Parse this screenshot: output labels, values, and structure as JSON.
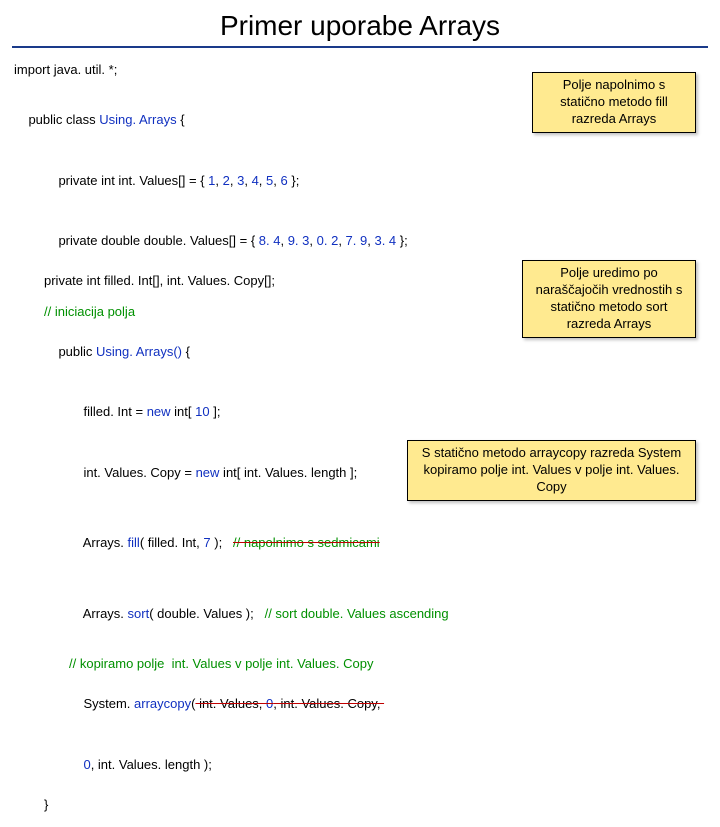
{
  "title": "Primer uporabe Arrays",
  "code": {
    "l1": "import java. util. *;",
    "l2a": "public class ",
    "l2b": "Using. Arrays",
    "l2c": " {",
    "l3a": "private int int. Values[] = { ",
    "l3b": "1",
    "l3c": "2",
    "l3d": "3",
    "l3e": "4",
    "l3f": "5",
    "l3g": "6",
    "l3h": " };",
    "l4a": "private double double. Values[] = { ",
    "l4b": "8. 4",
    "l4c": "9. 3",
    "l4d": "0. 2",
    "l4e": "7. 9",
    "l4f": "3. 4",
    "l4g": " };",
    "l5": "private int filled. Int[], int. Values. Copy[];",
    "l6": "// iniciacija polja",
    "l7a": "public ",
    "l7b": "Using. Arrays()",
    "l7c": " {",
    "l8a": "filled. Int = ",
    "l8b": "new",
    "l8c": " int[ ",
    "l8d": "10",
    "l8e": " ];",
    "l9a": "int. Values. Copy = ",
    "l9b": "new",
    "l9c": " int[ int. Values. length ];",
    "l10a": "Arrays. ",
    "l10b": "fill",
    "l10c": "( filled. Int, ",
    "l10d": "7",
    "l10e": " );   ",
    "l10f": "// napolnimo s sedmicami",
    "l11a": "Arrays. ",
    "l11b": "sort",
    "l11c": "( double. Values );   ",
    "l11d": "// sort double. Values ascending",
    "l12": "// kopiramo polje  int. Values v polje int. Values. Copy",
    "l13a": "System. ",
    "l13b": "arraycopy",
    "l13c": "(",
    "l13d": " int. Values, ",
    "l13e": "0",
    "l13f": ", int. Values. Copy, ",
    "l13g": "0",
    "l13h": ", int. Values. length );",
    "l14": "}"
  },
  "callouts": {
    "c1": "Polje napolnimo s statično metodo fill razreda Arrays",
    "c2": "Polje uredimo po naraščajočih vrednostih s statično metodo sort razreda Arrays",
    "c3": "S statično metodo arraycopy razreda System kopiramo polje int. Values  v polje int. Values. Copy"
  }
}
